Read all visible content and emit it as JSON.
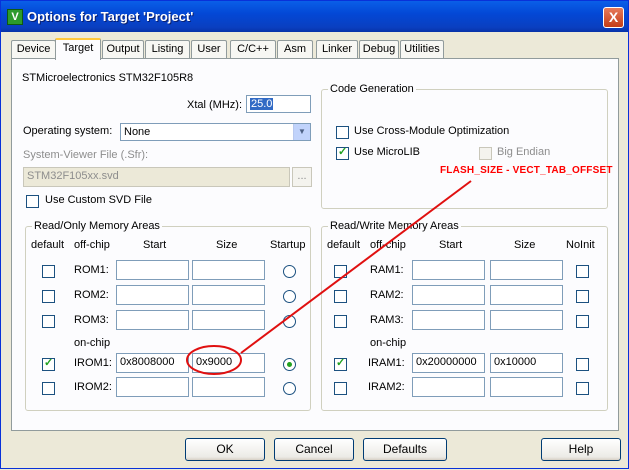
{
  "window": {
    "title": "Options for Target 'Project'",
    "close": "X",
    "app_icon": "V"
  },
  "tabs": [
    "Device",
    "Target",
    "Output",
    "Listing",
    "User",
    "C/C++",
    "Asm",
    "Linker",
    "Debug",
    "Utilities"
  ],
  "active_tab": "Target",
  "device": "STMicroelectronics STM32F105R8",
  "xtal": {
    "label": "Xtal (MHz):",
    "value": "25.0"
  },
  "os": {
    "label": "Operating system:",
    "value": "None"
  },
  "svd": {
    "label": "System-Viewer File (.Sfr):",
    "value": "STM32F105xx.svd",
    "browse": "...",
    "custom_label": "Use Custom SVD File"
  },
  "codegen": {
    "title": "Code Generation",
    "cross_module": "Use Cross-Module Optimization",
    "microlib": "Use MicroLIB",
    "big_endian": "Big Endian"
  },
  "rom": {
    "title": "Read/Only Memory Areas",
    "headers": {
      "default": "default",
      "offchip": "off-chip",
      "start": "Start",
      "size": "Size",
      "startup": "Startup"
    },
    "onchip": "on-chip",
    "rows": [
      {
        "name": "ROM1:",
        "start": "",
        "size": ""
      },
      {
        "name": "ROM2:",
        "start": "",
        "size": ""
      },
      {
        "name": "ROM3:",
        "start": "",
        "size": ""
      },
      {
        "name": "IROM1:",
        "start": "0x8008000",
        "size": "0x9000"
      },
      {
        "name": "IROM2:",
        "start": "",
        "size": ""
      }
    ]
  },
  "ram": {
    "title": "Read/Write Memory Areas",
    "headers": {
      "default": "default",
      "offchip": "off-chip",
      "start": "Start",
      "size": "Size",
      "noinit": "NoInit"
    },
    "onchip": "on-chip",
    "rows": [
      {
        "name": "RAM1:",
        "start": "",
        "size": ""
      },
      {
        "name": "RAM2:",
        "start": "",
        "size": ""
      },
      {
        "name": "RAM3:",
        "start": "",
        "size": ""
      },
      {
        "name": "IRAM1:",
        "start": "0x20000000",
        "size": "0x10000"
      },
      {
        "name": "IRAM2:",
        "start": "",
        "size": ""
      }
    ]
  },
  "annotation": "FLASH_SIZE - VECT_TAB_OFFSET",
  "annotation_color": "#ff0000",
  "buttons": {
    "ok": "OK",
    "cancel": "Cancel",
    "defaults": "Defaults",
    "help": "Help"
  }
}
